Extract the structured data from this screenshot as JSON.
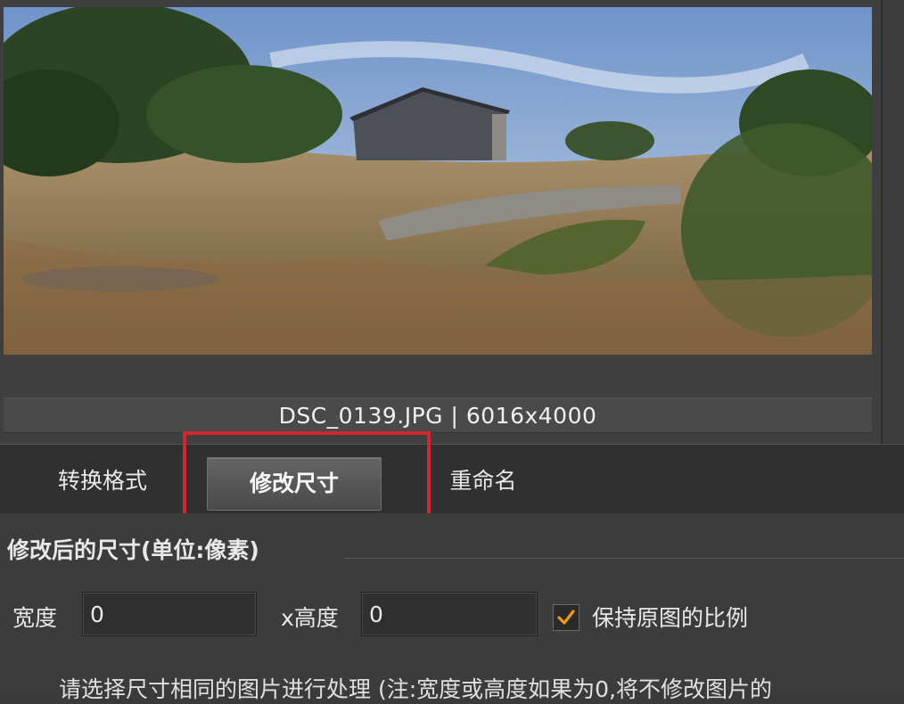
{
  "preview": {
    "caption": "DSC_0139.JPG | 6016x4000"
  },
  "tabs": [
    {
      "label": "转换格式"
    },
    {
      "label": "修改尺寸",
      "active": true
    },
    {
      "label": "重命名"
    }
  ],
  "resize_panel": {
    "section_title": "修改后的尺寸(单位:像素)",
    "width_label": "宽度",
    "width_value": "0",
    "height_label": "x高度",
    "height_value": "0",
    "keep_ratio_label": "保持原图的比例",
    "keep_ratio_checked": true,
    "hint": "请选择尺寸相同的图片进行处理 (注:宽度或高度如果为0,将不修改图片的"
  },
  "colors": {
    "highlight": "#d4262c",
    "check": "#f29a12"
  }
}
